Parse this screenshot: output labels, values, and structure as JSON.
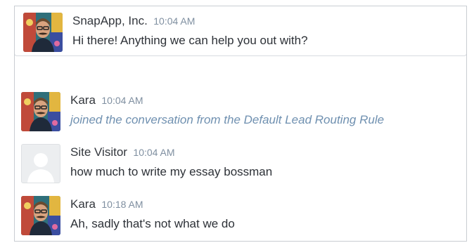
{
  "messages": [
    {
      "sender": "SnapApp, Inc.",
      "time": "10:04 AM",
      "text": "Hi there! Anything we can help you out with?",
      "avatar": "photo-avatar"
    },
    {
      "sender": "Kara",
      "time": "10:04 AM",
      "text": "joined the conversation from the Default Lead Routing Rule",
      "avatar": "photo-avatar",
      "system": true
    },
    {
      "sender": "Site Visitor",
      "time": "10:04 AM",
      "text": "how much to write my essay bossman",
      "avatar": "default-user-avatar"
    },
    {
      "sender": "Kara",
      "time": "10:18 AM",
      "text": "Ah, sadly that's not what we do",
      "avatar": "photo-avatar"
    }
  ],
  "colors": {
    "time": "#7f8fa0",
    "system_text": "#6f90b0",
    "border": "#c9cdd2"
  }
}
